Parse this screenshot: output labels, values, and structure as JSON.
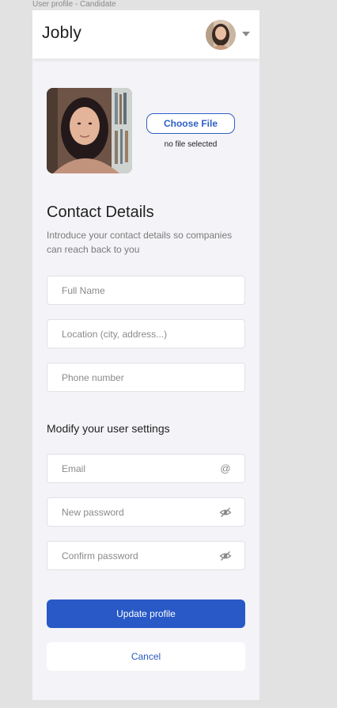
{
  "frame": {
    "label": "User profile - Candidate"
  },
  "header": {
    "brand": "Jobly",
    "avatar_icon": "user-avatar",
    "menu_icon": "chevron-down-icon"
  },
  "profile": {
    "choose_file_label": "Choose File",
    "file_status": "no file selected"
  },
  "contact": {
    "title": "Contact Details",
    "description": "Introduce your contact details so companies can reach back to you",
    "full_name_placeholder": "Full Name",
    "location_placeholder": "Location (city, address...)",
    "phone_placeholder": "Phone number"
  },
  "settings": {
    "title": "Modify your user settings",
    "email_placeholder": "Email",
    "email_icon": "@",
    "new_password_placeholder": "New password",
    "confirm_password_placeholder": "Confirm password"
  },
  "actions": {
    "update_label": "Update profile",
    "cancel_label": "Cancel"
  },
  "colors": {
    "primary": "#2859c6",
    "background": "#f4f4f8",
    "canvas": "#e2e2e2"
  }
}
